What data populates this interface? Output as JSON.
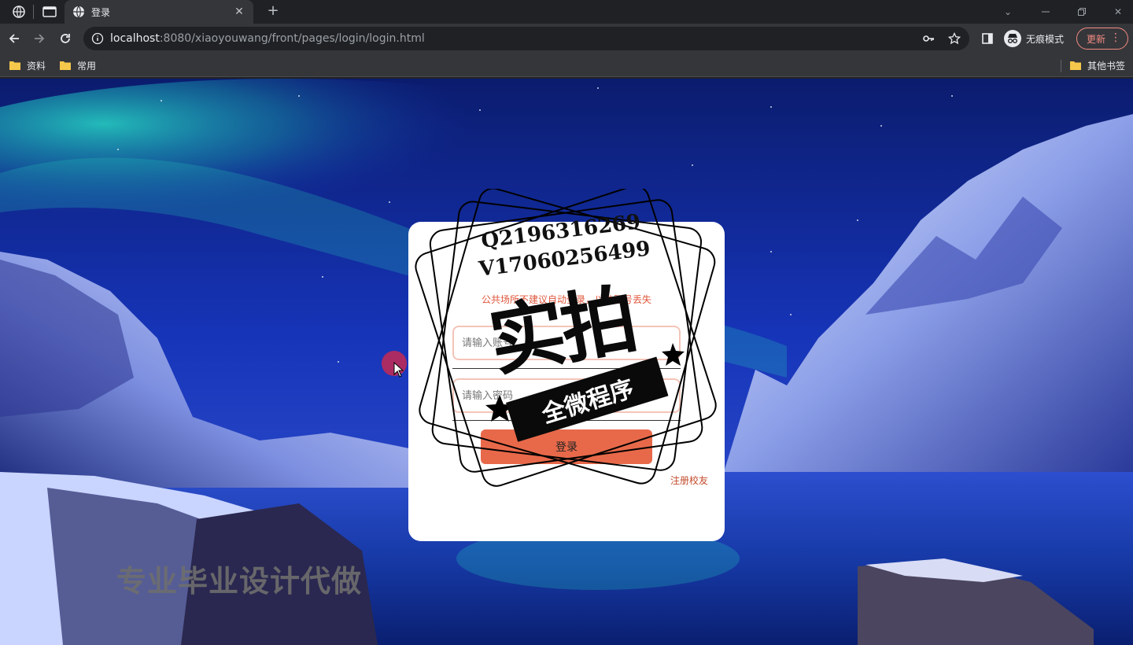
{
  "browser": {
    "tab_title": "登录",
    "url_host": "localhost",
    "url_rest": ":8080/xiaoyouwang/front/pages/login/login.html",
    "profile_label": "无痕模式",
    "update_label": "更新",
    "bookmarks": [
      {
        "label": "资料"
      },
      {
        "label": "常用"
      }
    ],
    "other_bookmarks": "其他书签"
  },
  "login": {
    "notice": "公共场所不建议自动登录，以防账号丢失",
    "username_placeholder": "请输入账号",
    "password_placeholder": "请输入密码",
    "submit_label": "登录",
    "register_link": "注册校友"
  },
  "overlay": {
    "contact_q": "Q2196316269",
    "contact_v": "V17060256499",
    "stamp_big": "实拍",
    "stamp_banner": "全微程序",
    "bottom_watermark": "专业毕业设计代做"
  },
  "colors": {
    "accent_button": "#e8694a",
    "register_link": "#c24a2a",
    "notice_text": "#e0553a"
  }
}
